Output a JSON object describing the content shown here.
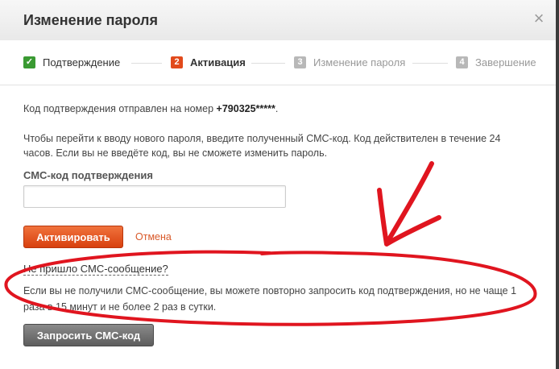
{
  "dialog": {
    "title": "Изменение пароля",
    "close_icon": "close-icon"
  },
  "steps": [
    {
      "num": "✓",
      "label": "Подтверждение",
      "state": "done"
    },
    {
      "num": "2",
      "label": "Активация",
      "state": "active"
    },
    {
      "num": "3",
      "label": "Изменение пароля",
      "state": "pending"
    },
    {
      "num": "4",
      "label": "Завершение",
      "state": "pending"
    }
  ],
  "content": {
    "sent_prefix": "Код подтверждения отправлен на номер ",
    "sent_number": "+790325*****",
    "sent_suffix": ".",
    "instructions": "Чтобы перейти к вводу нового пароля, введите полученный СМС-код. Код действителен в течение 24 часов. Если вы не введёте код, вы не сможете изменить пароль.",
    "sms_label": "СМС-код подтверждения",
    "sms_value": "",
    "activate_label": "Активировать",
    "cancel_label": "Отмена",
    "no_sms_link": "Не пришло СМС-сообщение?",
    "resend_info": "Если вы не получили СМС-сообщение, вы можете повторно запросить код подтверждения, но не чаще 1 раза в 15 минут и не более 2 раз в сутки.",
    "request_label": "Запросить СМС-код"
  },
  "colors": {
    "accent": "#e24a1b",
    "done": "#3a9a32",
    "annotation": "#e0151f"
  }
}
